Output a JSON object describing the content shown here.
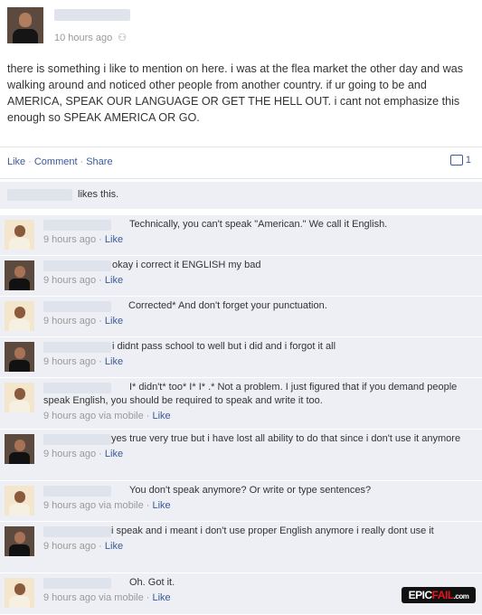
{
  "post": {
    "timestamp": "10 hours ago",
    "privacy_icon": "friends-icon",
    "text": "there is something i like to mention on here. i was at the flea market the other day and was walking around and noticed other people from another country. if ur going to be and AMERICA, SPEAK OUR LANGUAGE OR GET THE HELL OUT. i cant not emphasize this enough so SPEAK AMERICA OR GO."
  },
  "actions": {
    "like": "Like",
    "comment": "Comment",
    "share": "Share",
    "sep": "·",
    "comment_count": "1"
  },
  "likes": {
    "text": "likes this."
  },
  "comments": [
    {
      "text": "Technically, you can't speak \"American.\" We call it English.",
      "time": "9 hours ago",
      "via": "",
      "like": "Like"
    },
    {
      "text": "okay i correct it ENGLISH my bad",
      "time": "9 hours ago",
      "via": "",
      "like": "Like"
    },
    {
      "text": "Corrected* And don't forget your punctuation.",
      "time": "9 hours ago",
      "via": "",
      "like": "Like"
    },
    {
      "text": "i didnt pass school to well but i did and i forgot it all",
      "time": "9 hours ago",
      "via": "",
      "like": "Like"
    },
    {
      "text": "I* didn't* too* I* I* .* Not a problem. I just figured that if you demand people speak English, you should be required to speak and write it too.",
      "time": "9 hours ago",
      "via": "via mobile",
      "like": "Like"
    },
    {
      "text": "yes true very true but i have lost all ability to do that since i don't use it anymore",
      "time": "9 hours ago",
      "via": "",
      "like": "Like"
    },
    {
      "text": "You don't speak anymore? Or write or type sentences?",
      "time": "9 hours ago",
      "via": "via mobile",
      "like": "Like"
    },
    {
      "text": "i speak and i meant i don't use proper English anymore i really dont use it",
      "time": "9 hours ago",
      "via": "",
      "like": "Like"
    },
    {
      "text": "Oh. Got it.",
      "time": "9 hours ago",
      "via": "via mobile",
      "like": "Like"
    }
  ],
  "watermark": {
    "epic": "EPIC",
    "fail": "FAIL",
    "com": ".com"
  }
}
